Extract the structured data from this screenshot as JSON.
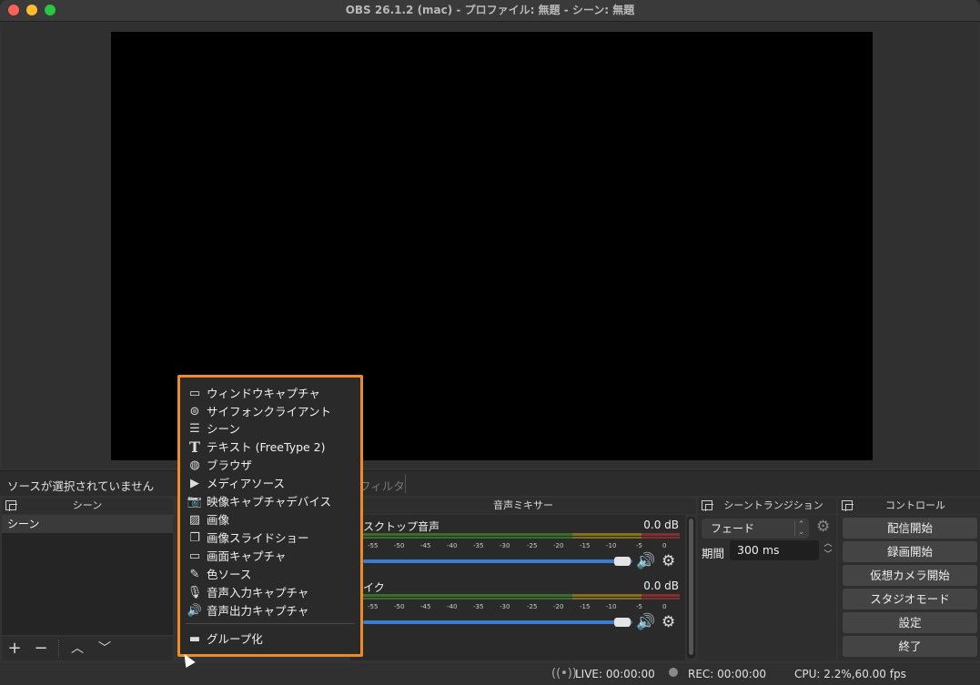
{
  "window": {
    "title": "OBS 26.1.2 (mac) - プロファイル: 無題 - シーン: 無題"
  },
  "source_bar": {
    "no_source": "ソースが選択されていません",
    "filter": "フィルタ"
  },
  "docks": {
    "scenes": "シーン",
    "mixer": "音声ミキサー",
    "transitions": "シーントランジション",
    "controls": "コントロール"
  },
  "scenes": {
    "items": [
      "シーン"
    ]
  },
  "mixer": {
    "channels": [
      {
        "name": "スクトップ音声",
        "db": "0.0 dB"
      },
      {
        "name": "イク",
        "db": "0.0 dB"
      }
    ],
    "ticks": [
      "-55",
      "-50",
      "-45",
      "-40",
      "-35",
      "-30",
      "-25",
      "-20",
      "-15",
      "-10",
      "-5",
      "0"
    ],
    "volume_fraction": 1.0
  },
  "transitions": {
    "selected": "フェード",
    "duration_label": "期間",
    "duration_value": "300 ms"
  },
  "controls": {
    "buttons": [
      "配信開始",
      "録画開始",
      "仮想カメラ開始",
      "スタジオモード",
      "設定",
      "終了"
    ]
  },
  "statusbar": {
    "live": "LIVE: 00:00:00",
    "rec": "REC: 00:00:00",
    "cpu": "CPU: 2.2%,60.00 fps"
  },
  "context_menu": {
    "items": [
      {
        "label": "ウィンドウキャプチャ",
        "icon": "window-icon"
      },
      {
        "label": "サイフォンクライアント",
        "icon": "gamepad-icon"
      },
      {
        "label": "シーン",
        "icon": "list-icon"
      },
      {
        "label": "テキスト (FreeType 2)",
        "icon": "text-icon"
      },
      {
        "label": "ブラウザ",
        "icon": "globe-icon"
      },
      {
        "label": "メディアソース",
        "icon": "play-icon"
      },
      {
        "label": "映像キャプチャデバイス",
        "icon": "camera-icon"
      },
      {
        "label": "画像",
        "icon": "image-icon"
      },
      {
        "label": "画像スライドショー",
        "icon": "slideshow-icon"
      },
      {
        "label": "画面キャプチャ",
        "icon": "monitor-icon"
      },
      {
        "label": "色ソース",
        "icon": "brush-icon"
      },
      {
        "label": "音声入力キャプチャ",
        "icon": "microphone-icon"
      },
      {
        "label": "音声出力キャプチャ",
        "icon": "speaker-icon"
      }
    ],
    "group": {
      "label": "グループ化",
      "icon": "folder-icon"
    },
    "highlight_color": "#f08a24"
  }
}
